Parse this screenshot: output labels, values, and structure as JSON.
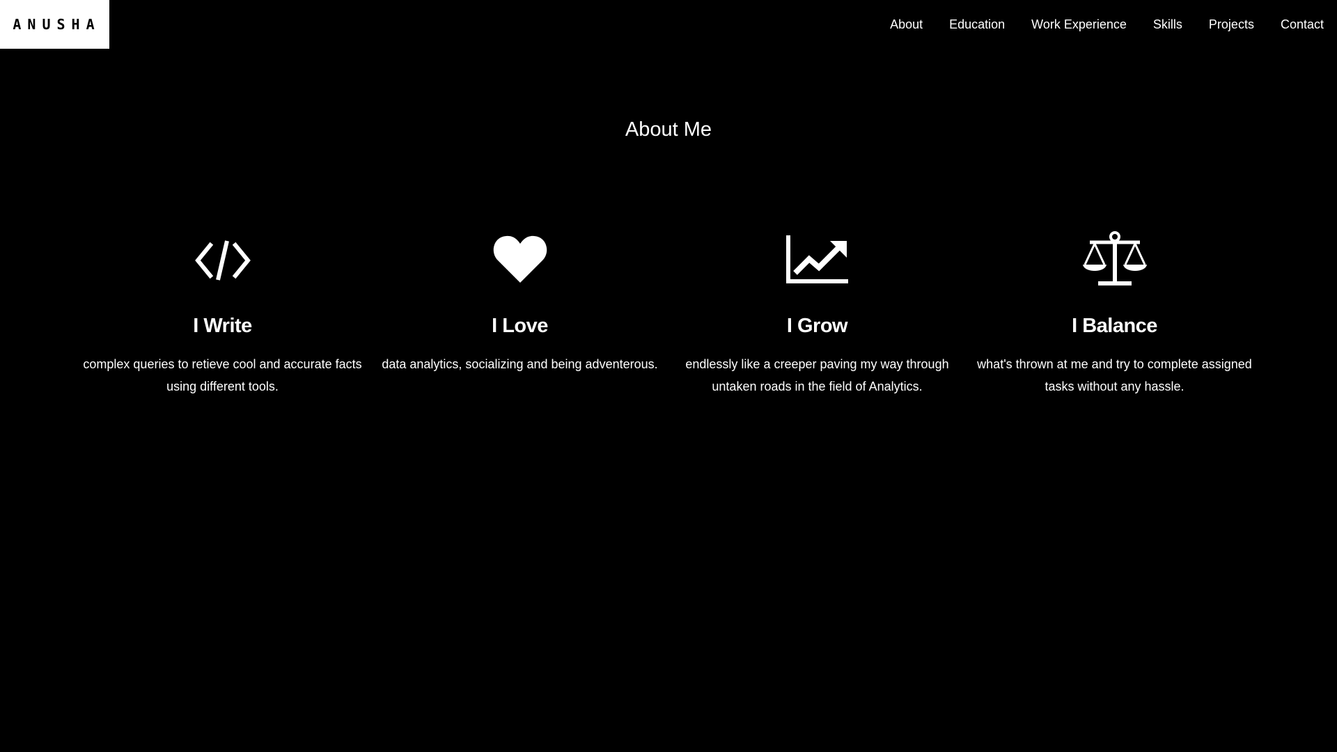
{
  "header": {
    "logo_text": "ANUSHA",
    "nav": [
      "About",
      "Education",
      "Work Experience",
      "Skills",
      "Projects",
      "Contact"
    ]
  },
  "about": {
    "title": "About Me",
    "features": [
      {
        "icon": "code-icon",
        "title": "I Write",
        "description": "complex queries to retieve cool and accurate facts using different tools."
      },
      {
        "icon": "heart-icon",
        "title": "I Love",
        "description": "data analytics, socializing and being adventerous."
      },
      {
        "icon": "line-chart-icon",
        "title": "I Grow",
        "description": "endlessly like a creeper paving my way through untaken roads in the field of Analytics."
      },
      {
        "icon": "balance-scale-icon",
        "title": "I Balance",
        "description": "what's thrown at me and try to complete assigned tasks without any hassle."
      }
    ]
  },
  "colors": {
    "background": "#000000",
    "text": "#ffffff",
    "logo_background": "#ffffff",
    "logo_text": "#000000"
  }
}
